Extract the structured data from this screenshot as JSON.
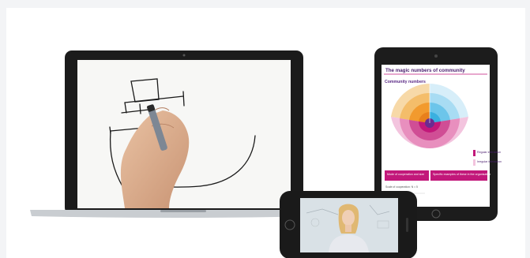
{
  "tablet": {
    "title": "The magic numbers of community",
    "subtitle": "Community numbers",
    "legend_regular": "Regular interaction",
    "legend_irregular": "Irregular interaction",
    "table_col1": "Mode of cooperation and size",
    "table_col2": "Specific examples of these in the organisation",
    "footnote": "Scale of cooperation: N ≈ 5"
  },
  "colors": {
    "magenta": "#c2187a",
    "orange": "#f29a2e",
    "cyan": "#3ab0e0",
    "purple": "#6a2c91",
    "bezel": "#1c1c1c"
  }
}
